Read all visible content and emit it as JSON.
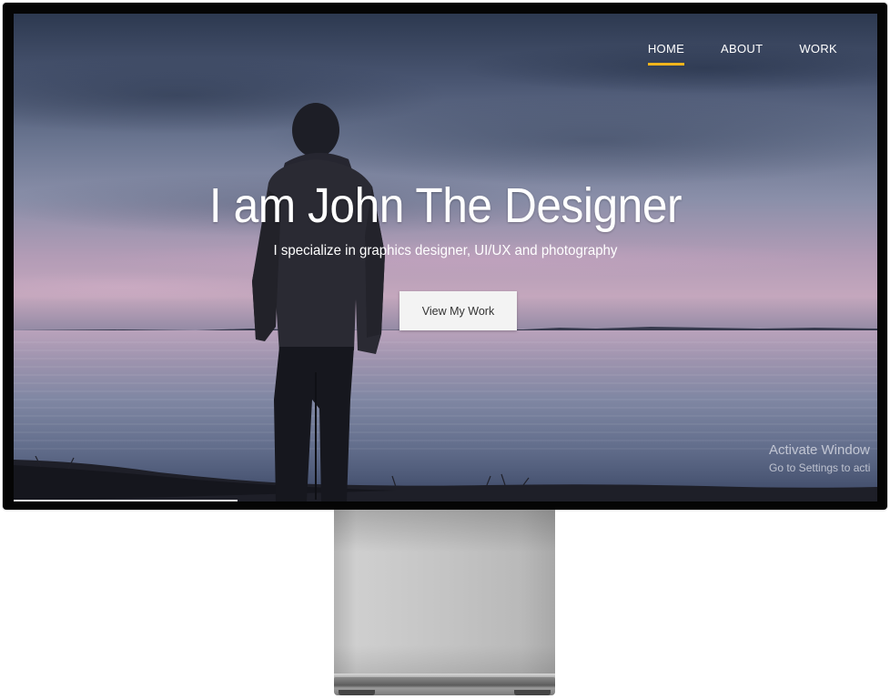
{
  "nav": {
    "items": [
      {
        "label": "HOME",
        "active": true
      },
      {
        "label": "ABOUT",
        "active": false
      },
      {
        "label": "WORK",
        "active": false
      }
    ]
  },
  "hero": {
    "title": "I am John The Designer",
    "subtitle": "I specialize in graphics designer, UI/UX and photography",
    "cta_label": "View My Work"
  },
  "watermark": {
    "line1": "Activate Window",
    "line2": "Go to Settings to acti"
  },
  "colors": {
    "accent": "#f0b41c",
    "button_bg": "#f3f3f3",
    "text": "#ffffff"
  }
}
